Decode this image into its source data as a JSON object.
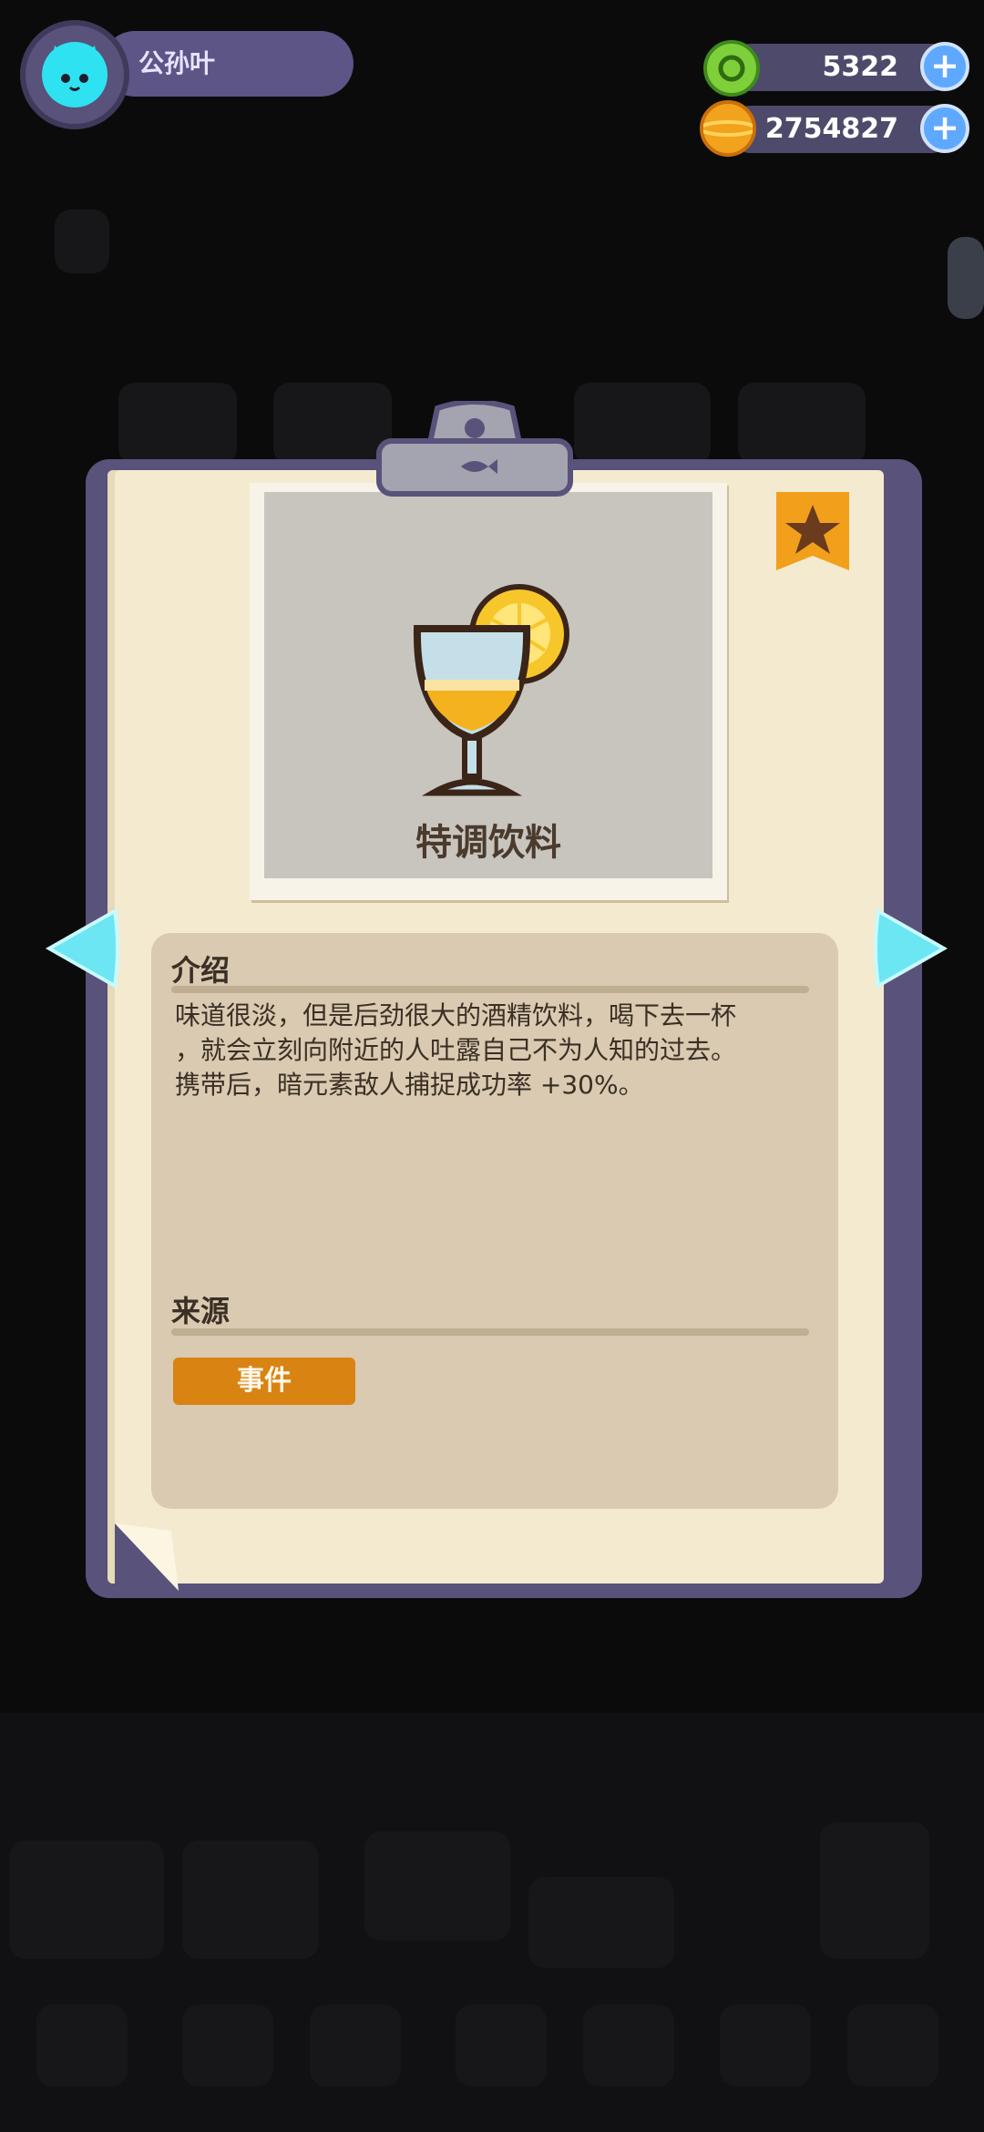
{
  "player": {
    "name": "公孙叶"
  },
  "currency": {
    "gems": {
      "value": "5322",
      "icon": "green-orb-icon"
    },
    "coins": {
      "value": "2754827",
      "icon": "gold-planet-coin-icon"
    }
  },
  "item": {
    "name": "特调饮料",
    "icon": "cocktail-glass-lemon-icon",
    "favorite_icon": "star-bookmark-icon",
    "intro_title": "介绍",
    "description_lines": [
      "味道很淡，但是后劲很大的酒精饮料，喝下去一杯",
      "，就会立刻向附近的人吐露自己不为人知的过去。",
      "携带后，暗元素敌人捕捉成功率 +30%。"
    ],
    "source_title": "来源",
    "source_tag": "事件"
  },
  "colors": {
    "accent_cyan": "#2fe2f1",
    "board_purple": "#59527a",
    "paper": "#f4ead0",
    "tag_orange": "#d98313"
  }
}
